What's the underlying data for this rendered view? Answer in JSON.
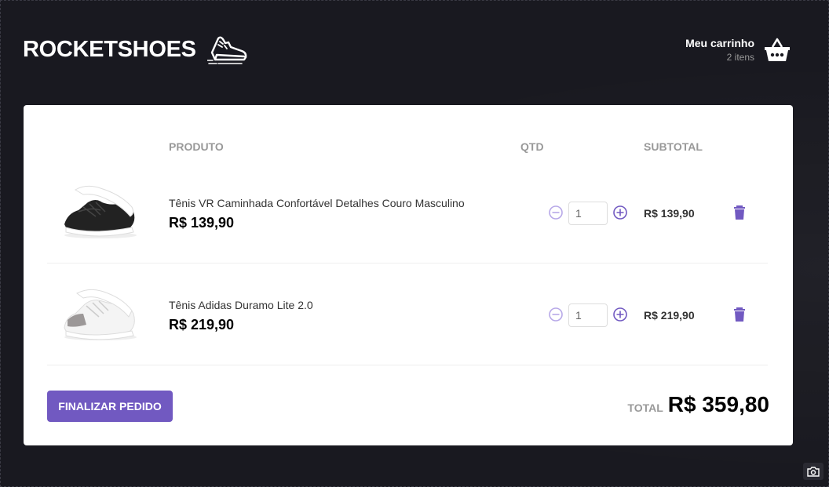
{
  "app": {
    "logo_text": "ROCKETSHOES",
    "logo_icon": "sneaker-icon"
  },
  "cart_link": {
    "title": "Meu carrinho",
    "count": "2 itens",
    "icon": "basket-icon"
  },
  "table": {
    "headers": {
      "product": "PRODUTO",
      "qty": "QTD",
      "subtotal": "SUBTOTAL"
    },
    "rows": [
      {
        "name": "Tênis VR Caminhada Confortável Detalhes Couro Masculino",
        "price": "R$ 139,90",
        "quantity": "1",
        "subtotal": "R$ 139,90",
        "shoe_color": "#222222"
      },
      {
        "name": "Tênis Adidas Duramo Lite 2.0",
        "price": "R$ 219,90",
        "quantity": "1",
        "subtotal": "R$ 219,90",
        "shoe_color": "#f2f2f2"
      }
    ]
  },
  "footer": {
    "checkout_label": "FINALIZAR PEDIDO",
    "total_label": "TOTAL",
    "total_value": "R$ 359,80"
  },
  "colors": {
    "background": "#191920",
    "accent": "#7159c1",
    "card": "#ffffff"
  }
}
